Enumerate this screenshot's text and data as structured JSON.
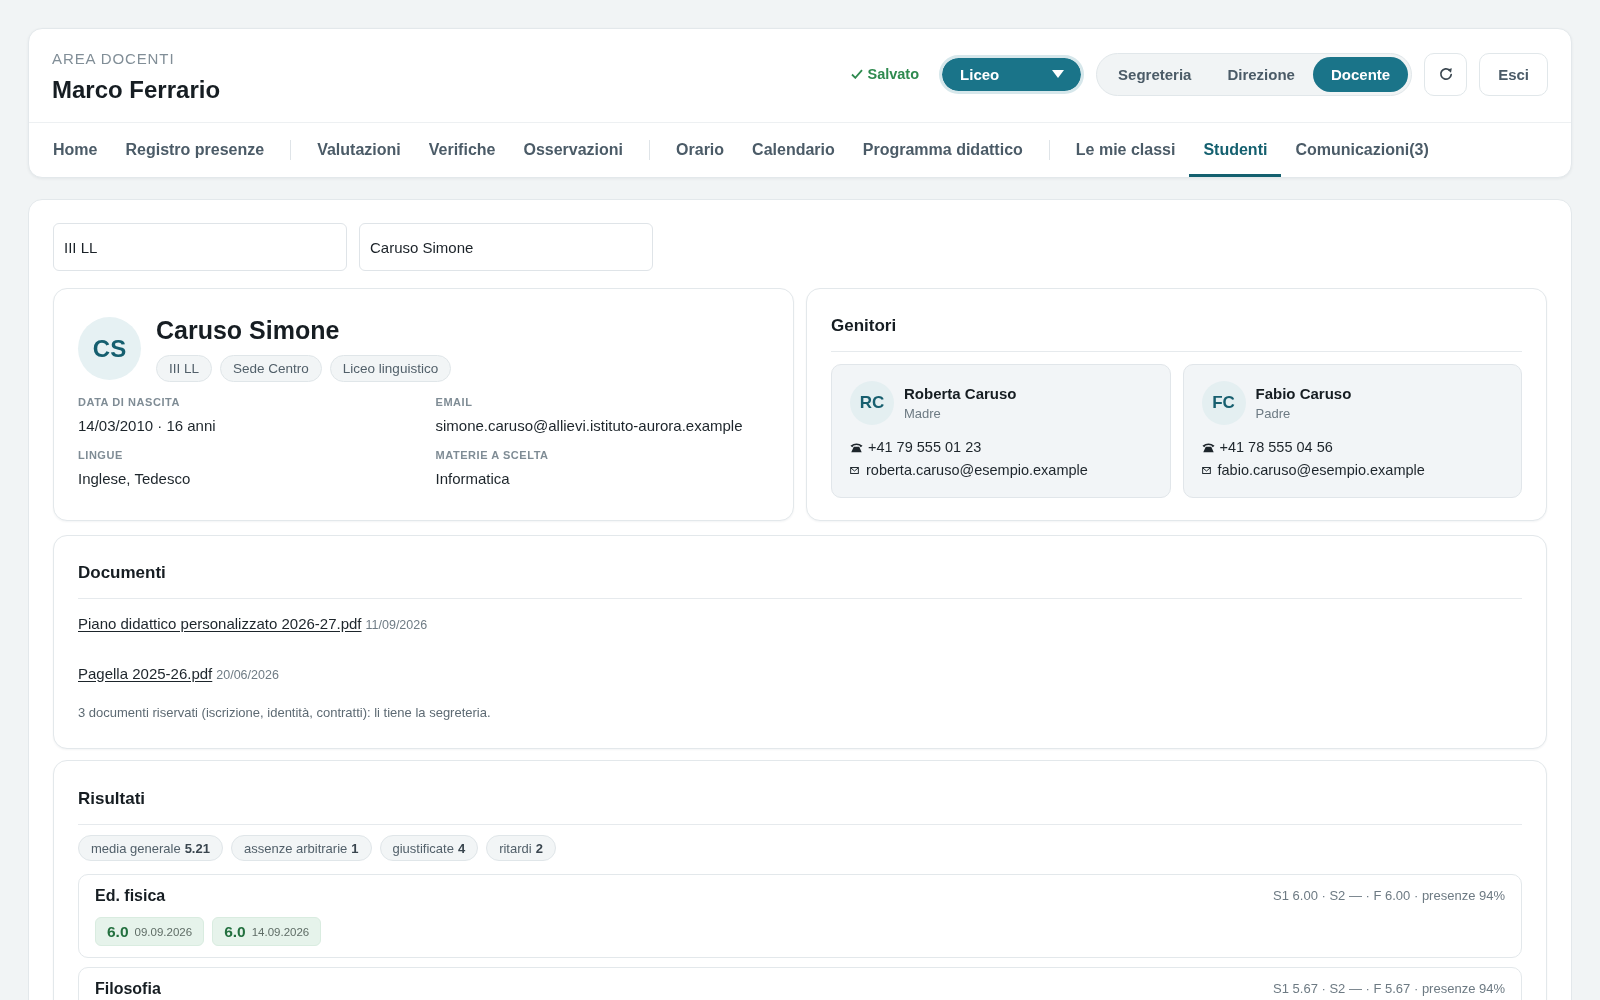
{
  "header": {
    "eyebrow": "AREA DOCENTI",
    "user_name": "Marco Ferrario",
    "save_status": "Salvato",
    "school_select": {
      "value": "Liceo"
    },
    "roles": [
      {
        "label": "Segreteria",
        "selected": false
      },
      {
        "label": "Direzione",
        "selected": false
      },
      {
        "label": "Docente",
        "selected": true
      }
    ],
    "exit_button": {
      "label": "Esci"
    }
  },
  "nav": {
    "groups": [
      {
        "items": [
          {
            "label": "Home",
            "selected": false
          },
          {
            "label": "Registro presenze",
            "selected": false
          }
        ]
      },
      {
        "items": [
          {
            "label": "Valutazioni",
            "selected": false
          },
          {
            "label": "Verifiche",
            "selected": false
          },
          {
            "label": "Osservazioni",
            "selected": false
          }
        ]
      },
      {
        "items": [
          {
            "label": "Orario",
            "selected": false
          },
          {
            "label": "Calendario",
            "selected": false
          },
          {
            "label": "Programma didattico",
            "selected": false
          }
        ]
      },
      {
        "items": [
          {
            "label": "Le mie classi",
            "selected": false
          },
          {
            "label": "Studenti",
            "selected": true
          },
          {
            "label": "Comunicazioni(3)",
            "selected": false
          }
        ]
      }
    ]
  },
  "filters": [
    {
      "value": "III LL"
    },
    {
      "value": "Caruso Simone"
    }
  ],
  "student": {
    "initials": "CS",
    "name": "Caruso Simone",
    "tags": [
      "III LL",
      "Sede Centro",
      "Liceo linguistico"
    ],
    "fields": [
      {
        "label": "DATA DI NASCITA",
        "value": "14/03/2010 · 16 anni"
      },
      {
        "label": "EMAIL",
        "value": "simone.caruso@allievi.istituto-aurora.example"
      },
      {
        "label": "LINGUE",
        "value": "Inglese, Tedesco"
      },
      {
        "label": "MATERIE A SCELTA",
        "value": "Informatica"
      }
    ]
  },
  "parents": {
    "title": "Genitori",
    "items": [
      {
        "initials": "RC",
        "name": "Roberta Caruso",
        "role": "Madre",
        "phone": "+41 79 555 01 23",
        "email": "roberta.caruso@esempio.example"
      },
      {
        "initials": "FC",
        "name": "Fabio Caruso",
        "role": "Padre",
        "phone": "+41 78 555 04 56",
        "email": "fabio.caruso@esempio.example"
      }
    ]
  },
  "documents": {
    "title": "Documenti",
    "files": [
      {
        "name": "Piano didattico personalizzato 2026-27.pdf",
        "date": "11/09/2026"
      },
      {
        "name": "Pagella 2025-26.pdf",
        "date": "20/06/2026"
      }
    ],
    "note": "3 documenti riservati (iscrizione, identità, contratti): li tiene la segreteria."
  },
  "results": {
    "title": "Risultati",
    "summary": [
      "media generale **5.21**",
      "assenze arbitrarie **1**",
      "giustificate **4**",
      "ritardi **2**"
    ],
    "subjects": [
      {
        "name": "Ed. fisica",
        "summary": "S1 6.00 · S2 — · F 6.00 · presenze 94%",
        "grades": [
          {
            "value": "6.0",
            "date": "09.09.2026"
          },
          {
            "value": "6.0",
            "date": "14.09.2026"
          }
        ]
      },
      {
        "name": "Filosofia",
        "summary": "S1 5.67 · S2 — · F 5.67 · presenze 94%"
      }
    ]
  }
}
